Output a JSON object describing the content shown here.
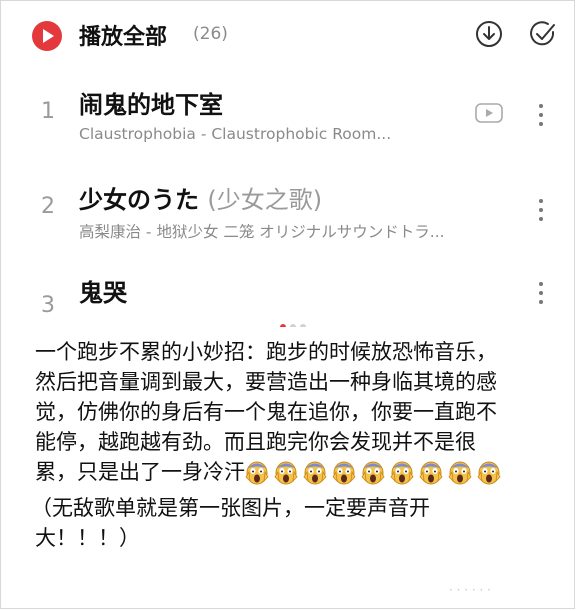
{
  "header": {
    "play_all_label": "播放全部",
    "count": "(26)",
    "download_icon": "download-icon",
    "select_icon": "check-circle-icon"
  },
  "playlist": {
    "items": [
      {
        "index": "1",
        "title": "闹鬼的地下室",
        "title_alt": "",
        "subtitle": "Claustrophobia - Claustrophobic Room...",
        "has_mv": true
      },
      {
        "index": "2",
        "title": "少女のうた ",
        "title_alt": "(少女之歌)",
        "subtitle": "高梨康治 - 地狱少女 二笼 オリジナルサウンドトラ...",
        "has_mv": false
      },
      {
        "index": "3",
        "title": "鬼哭",
        "title_alt": "",
        "subtitle": "",
        "has_mv": false
      }
    ],
    "page_dots": {
      "total": 3,
      "active": 1
    }
  },
  "post": {
    "lines": [
      "一个跑步不累的小妙招：跑步的时候放恐怖音乐，",
      "然后把音量调到最大，要营造出一种身临其境的感",
      "觉，仿佛你的身后有一个鬼在追你，你要一直跑不",
      "能停，越跑越有劲。而且跑完你会发现并不是很",
      "累，只是出了一身冷汗"
    ],
    "emoji_name": "screaming-face-icon",
    "emoji_count": 9,
    "note_lines": [
      "（无敌歌单就是第一张图片，一定要声音开",
      "大！！！）"
    ]
  },
  "colors": {
    "accent": "#e4393c",
    "muted": "#8a8a8a",
    "text": "#111111"
  }
}
